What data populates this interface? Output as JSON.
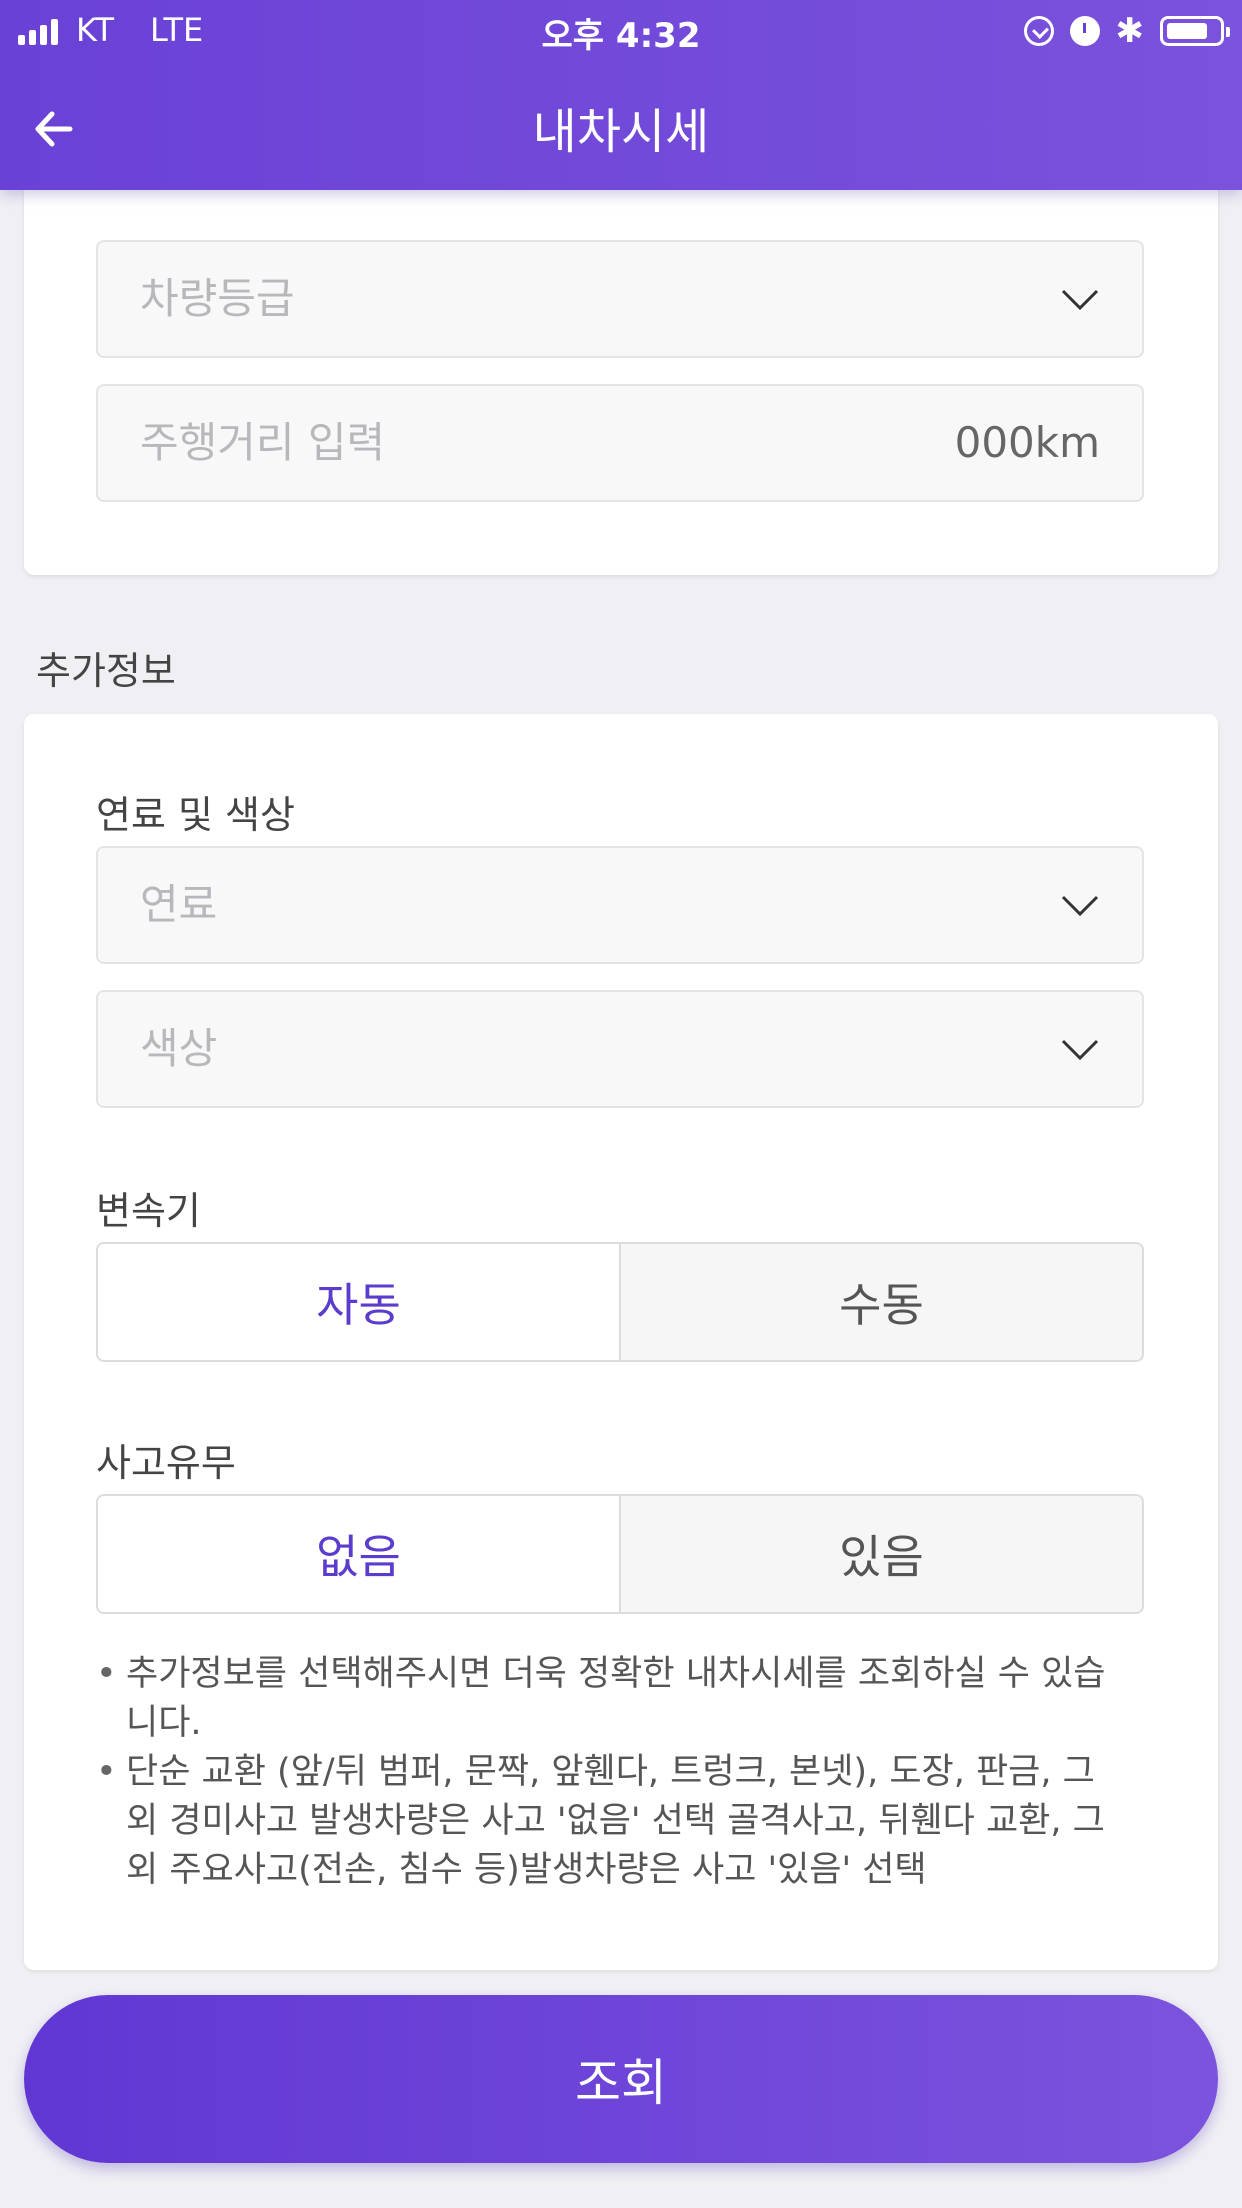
{
  "status_bar": {
    "carrier": "KT",
    "network": "LTE",
    "time": "오후 4:32",
    "battery_level": 0.8
  },
  "header": {
    "title": "내차시세",
    "back_icon": "arrow-left-icon"
  },
  "vehicle_info": {
    "grade_placeholder": "차량등급",
    "mileage_placeholder": "주행거리 입력",
    "mileage_unit_placeholder": "000km"
  },
  "additional_info": {
    "section_title": "추가정보",
    "fuel_color_label": "연료 및 색상",
    "fuel_placeholder": "연료",
    "color_placeholder": "색상",
    "transmission": {
      "label": "변속기",
      "options": [
        "자동",
        "수동"
      ],
      "selected": "자동"
    },
    "accident": {
      "label": "사고유무",
      "options": [
        "없음",
        "있음"
      ],
      "selected": "없음"
    },
    "notes": [
      "추가정보를 선택해주시면 더욱 정확한 내차시세를 조회하실 수 있습니다.",
      "단순 교환 (앞/뒤 범퍼, 문짝, 앞휀다, 트렁크, 본넷), 도장, 판금, 그 외 경미사고 발생차량은 사고 '없음' 선택 골격사고, 뒤휀다 교환, 그 외 주요사고(전손, 침수 등)발생차량은 사고 '있음' 선택"
    ]
  },
  "submit_label": "조회",
  "colors": {
    "primary": "#6a41d6",
    "active_text": "#5b3ccc",
    "background": "#f0f0f4"
  }
}
